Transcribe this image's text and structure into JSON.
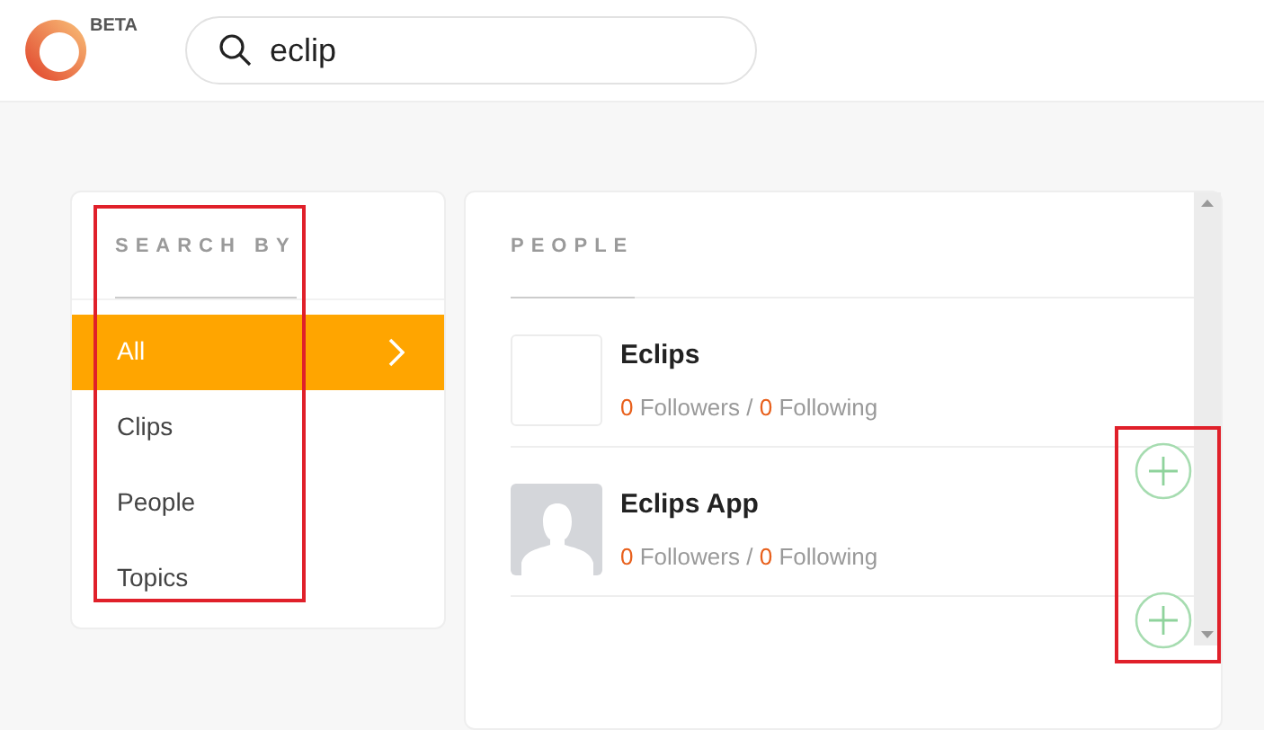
{
  "header": {
    "badge": "BETA",
    "search": {
      "value": "eclip"
    }
  },
  "sidebar": {
    "title": "SEARCH BY",
    "items": [
      {
        "label": "All",
        "selected": true
      },
      {
        "label": "Clips",
        "selected": false
      },
      {
        "label": "People",
        "selected": false
      },
      {
        "label": "Topics",
        "selected": false
      }
    ]
  },
  "results": {
    "title": "PEOPLE",
    "people": [
      {
        "name": "Eclips",
        "kind": "blank",
        "followers": "0",
        "followers_label": "Followers",
        "separator": "/",
        "following": "0",
        "following_label": "Following"
      },
      {
        "name": "Eclips App",
        "kind": "silhouette",
        "followers": "0",
        "followers_label": "Followers",
        "separator": "/",
        "following": "0",
        "following_label": "Following"
      }
    ]
  }
}
